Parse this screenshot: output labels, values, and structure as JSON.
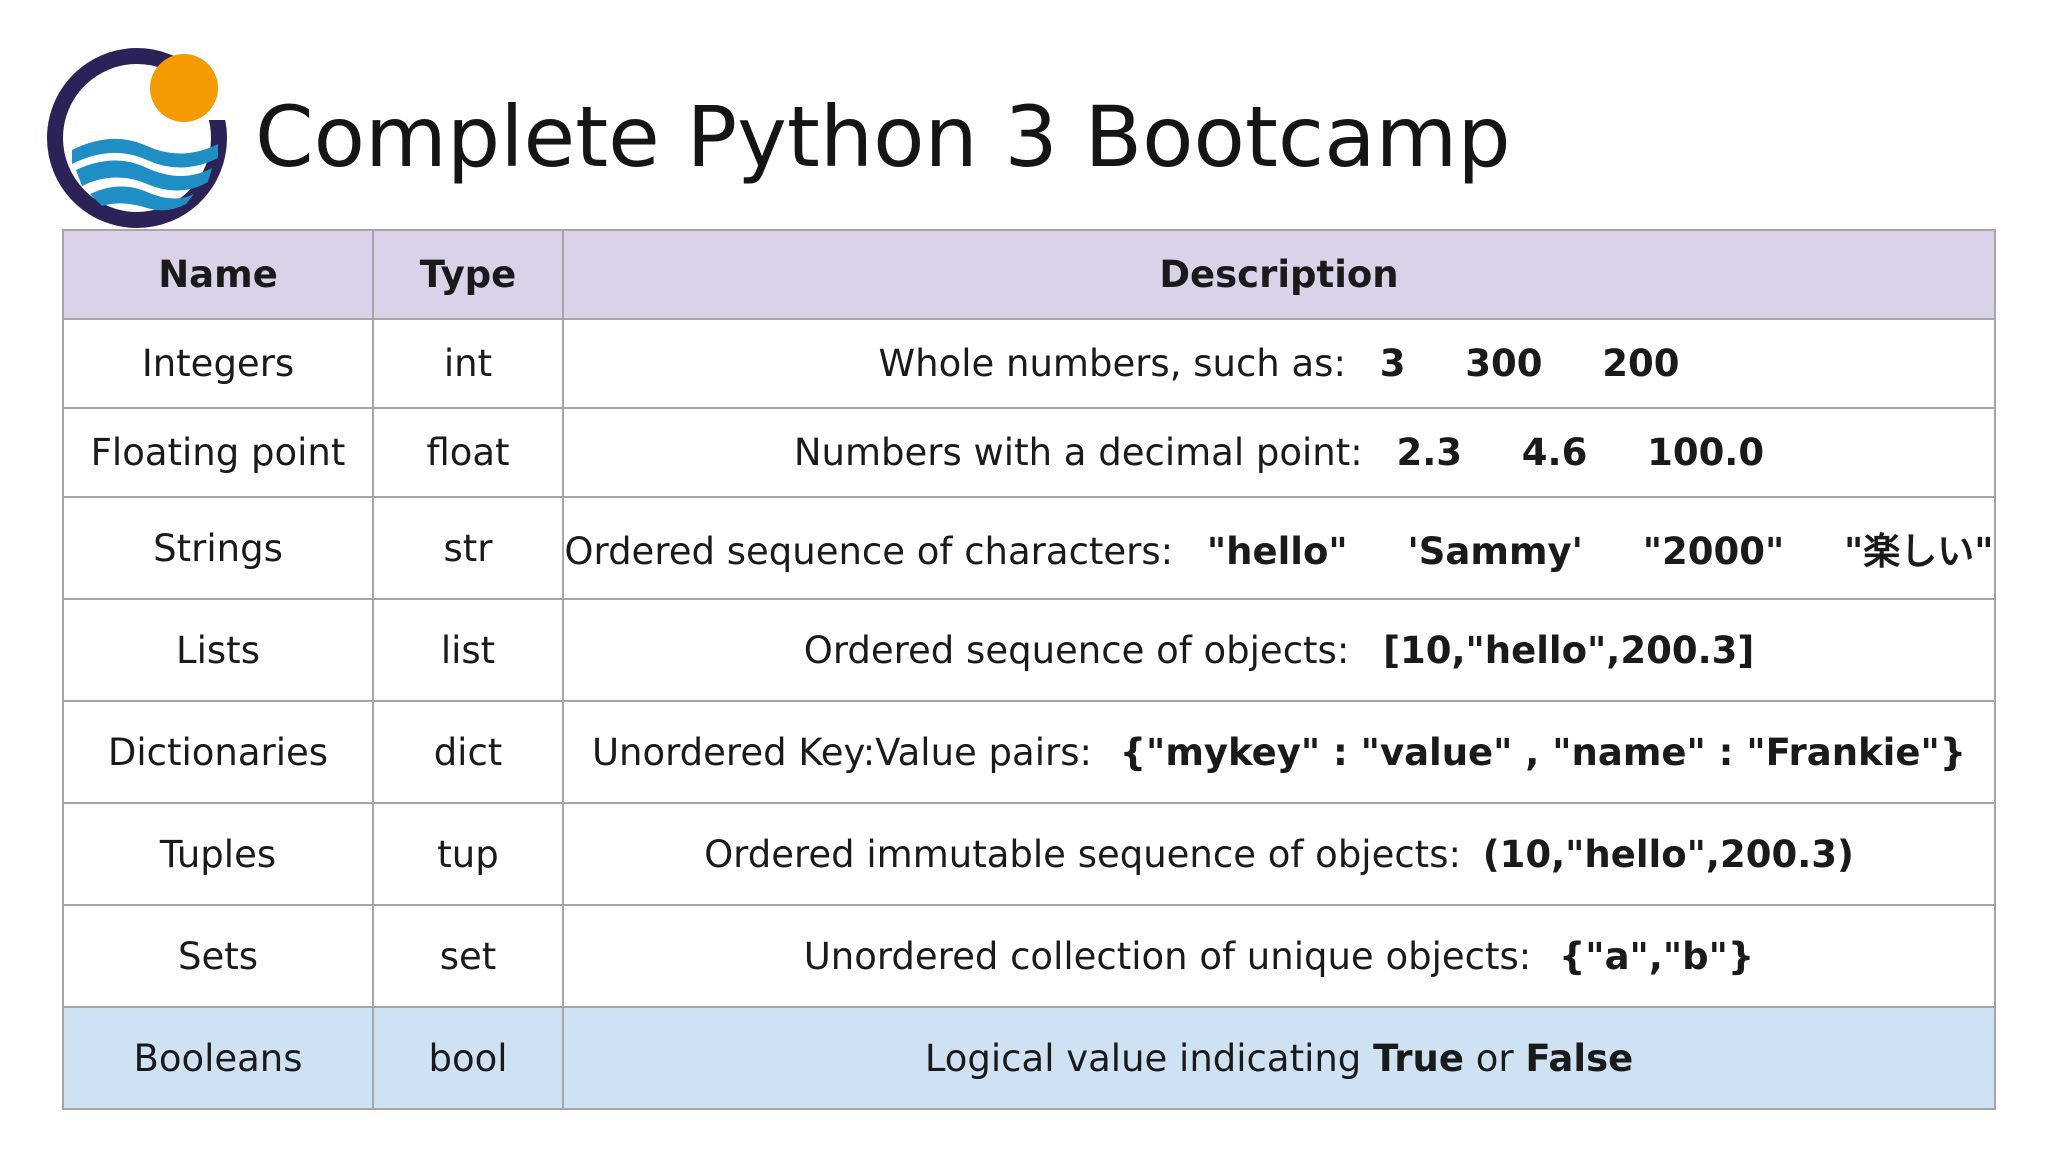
{
  "title": "Complete Python 3 Bootcamp",
  "colors": {
    "header_row": "#d9d2e9",
    "highlight_row": "#cfe2f3",
    "logo_ring": "#2c2257",
    "logo_sun": "#f39a00",
    "logo_wave": "#1f8ec4"
  },
  "table": {
    "headers": [
      "Name",
      "Type",
      "Description"
    ],
    "rows": [
      {
        "name": "Integers",
        "type": "int",
        "desc": "Whole numbers, such as:",
        "examples": [
          "3",
          "300",
          "200"
        ]
      },
      {
        "name": "Floating point",
        "type": "float",
        "desc": "Numbers with a decimal point:",
        "examples": [
          "2.3",
          "4.6",
          "100.0"
        ]
      },
      {
        "name": "Strings",
        "type": "str",
        "desc": "Ordered sequence of characters:",
        "examples": [
          "\"hello\"",
          "'Sammy'",
          "\"2000\"",
          "\"楽しい\""
        ]
      },
      {
        "name": "Lists",
        "type": "list",
        "desc": "Ordered sequence of objects:",
        "examples": [
          "[10,\"hello\",200.3]"
        ]
      },
      {
        "name": "Dictionaries",
        "type": "dict",
        "desc": "Unordered Key:Value pairs:",
        "examples": [
          "{\"mykey\" : \"value\" , \"name\" : \"Frankie\"}"
        ]
      },
      {
        "name": "Tuples",
        "type": "tup",
        "desc": "Ordered immutable sequence of objects:",
        "examples": [
          "(10,\"hello\",200.3)"
        ]
      },
      {
        "name": "Sets",
        "type": "set",
        "desc": "Unordered collection of unique objects:",
        "examples": [
          "{\"a\",\"b\"}"
        ]
      },
      {
        "name": "Booleans",
        "type": "bool",
        "desc_prefix": "Logical value indicating",
        "true_word": "True",
        "joiner": "or",
        "false_word": "False"
      }
    ]
  }
}
